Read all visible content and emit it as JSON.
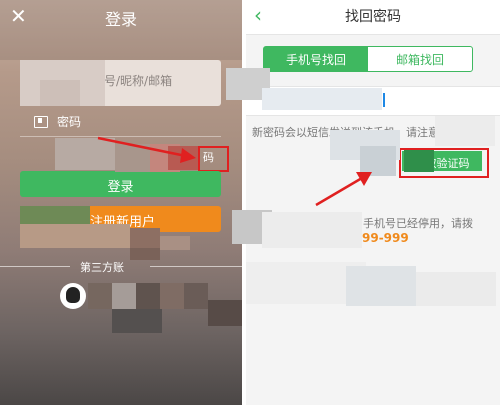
{
  "login": {
    "close_icon": "close-icon",
    "title": "登录",
    "account_placeholder": "号/昵称/邮箱",
    "password_label": "密码",
    "password_icon": "lock-icon",
    "forgot_label": "码",
    "login_label": "登录",
    "register_label": "注册新用户",
    "third_party_label": "第三方账",
    "qq_icon": "qq-icon"
  },
  "recover": {
    "back_icon": "chevron-left-icon",
    "title": "找回密码",
    "tabs": [
      {
        "label": "手机号找回",
        "active": true
      },
      {
        "label": "邮箱找回",
        "active": false
      }
    ],
    "hint": "新密码会以短信发送到该手机，请注意查",
    "get_code_label": "获取验证码",
    "disabled_text": "手机号已经停用，请拨",
    "service_phone": "99-999"
  },
  "colors": {
    "accent_green": "#3fb860",
    "accent_orange": "#f08a1c",
    "annotation_red": "#e02020"
  }
}
